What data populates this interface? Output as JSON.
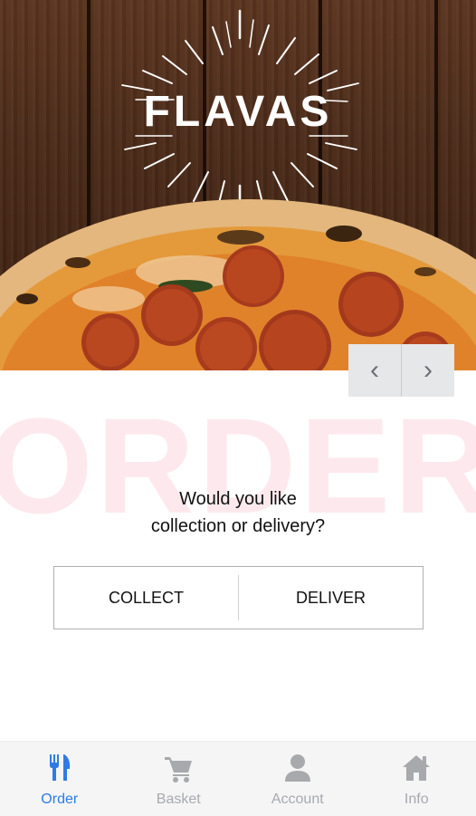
{
  "brand": {
    "name": "FLAVAS"
  },
  "hero": {
    "prev_glyph": "‹",
    "next_glyph": "›"
  },
  "order": {
    "watermark": "ORDER",
    "question_line1": "Would you like",
    "question_line2": "collection or delivery?",
    "collect_label": "COLLECT",
    "deliver_label": "DELIVER"
  },
  "nav": {
    "items": [
      {
        "label": "Order",
        "icon": "fork-knife-icon",
        "active": true
      },
      {
        "label": "Basket",
        "icon": "cart-icon",
        "active": false
      },
      {
        "label": "Account",
        "icon": "user-icon",
        "active": false
      },
      {
        "label": "Info",
        "icon": "home-icon",
        "active": false
      }
    ]
  },
  "colors": {
    "accent": "#2f7be5",
    "nav_inactive": "#a7a9ad",
    "watermark": "#fde9ed"
  }
}
